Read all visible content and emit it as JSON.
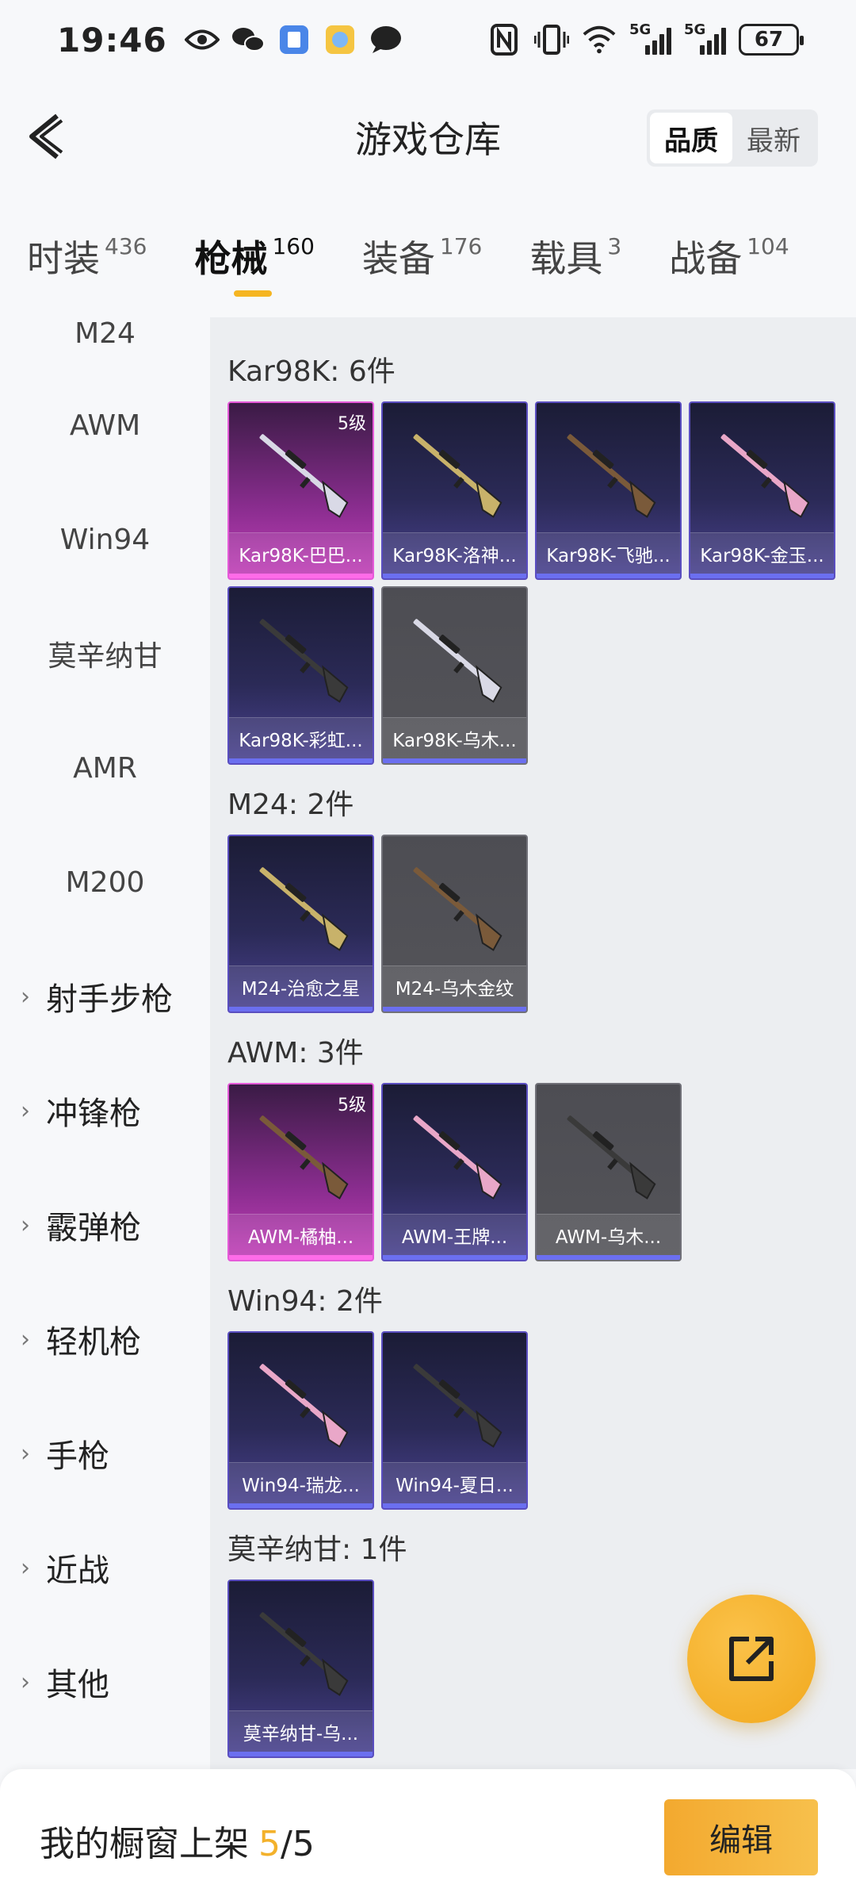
{
  "status_bar": {
    "time": "19:46",
    "battery": "67",
    "net1": "5G",
    "net2": "5G"
  },
  "header": {
    "title": "游戏仓库",
    "sort_options": [
      {
        "label": "品质",
        "active": true
      },
      {
        "label": "最新",
        "active": false
      }
    ]
  },
  "tabs": [
    {
      "label": "时装",
      "count": "436"
    },
    {
      "label": "枪械",
      "count": "160",
      "active": true
    },
    {
      "label": "装备",
      "count": "176"
    },
    {
      "label": "载具",
      "count": "3"
    },
    {
      "label": "战备",
      "count": "104"
    }
  ],
  "sidebar": {
    "items": [
      {
        "label": "M24"
      },
      {
        "label": "AWM"
      },
      {
        "label": "Win94"
      },
      {
        "label": "莫辛纳甘"
      },
      {
        "label": "AMR"
      },
      {
        "label": "M200"
      }
    ],
    "groups": [
      {
        "label": "射手步枪"
      },
      {
        "label": "冲锋枪"
      },
      {
        "label": "霰弹枪"
      },
      {
        "label": "轻机枪"
      },
      {
        "label": "手枪"
      },
      {
        "label": "近战"
      },
      {
        "label": "其他"
      }
    ]
  },
  "sections": [
    {
      "title": "Kar98K: 6件",
      "items": [
        {
          "name": "Kar98K-巴巴...",
          "quality": "pink",
          "level": "5级"
        },
        {
          "name": "Kar98K-洛神...",
          "quality": "purple"
        },
        {
          "name": "Kar98K-飞驰...",
          "quality": "purple"
        },
        {
          "name": "Kar98K-金玉...",
          "quality": "purple"
        },
        {
          "name": "Kar98K-彩虹...",
          "quality": "purple"
        },
        {
          "name": "Kar98K-乌木...",
          "quality": "gray"
        }
      ]
    },
    {
      "title": "M24: 2件",
      "items": [
        {
          "name": "M24-治愈之星",
          "quality": "purple"
        },
        {
          "name": "M24-乌木金纹",
          "quality": "gray"
        }
      ]
    },
    {
      "title": "AWM: 3件",
      "items": [
        {
          "name": "AWM-橘柚...",
          "quality": "pink",
          "level": "5级"
        },
        {
          "name": "AWM-王牌...",
          "quality": "purple"
        },
        {
          "name": "AWM-乌木...",
          "quality": "gray"
        }
      ]
    },
    {
      "title": "Win94: 2件",
      "items": [
        {
          "name": "Win94-瑞龙...",
          "quality": "purple"
        },
        {
          "name": "Win94-夏日...",
          "quality": "purple"
        }
      ]
    },
    {
      "title": "莫辛纳甘: 1件",
      "items": [
        {
          "name": "莫辛纳甘-乌...",
          "quality": "purple"
        }
      ]
    }
  ],
  "bottom": {
    "shelf_label": "我的橱窗上架",
    "shelf_current": "5",
    "shelf_total": "/5",
    "edit_label": "编辑"
  },
  "colors": {
    "accent": "#f5b521",
    "pink_quality": "#e55ad9",
    "purple_quality": "#5a4ec0",
    "gray_quality": "#707078"
  }
}
